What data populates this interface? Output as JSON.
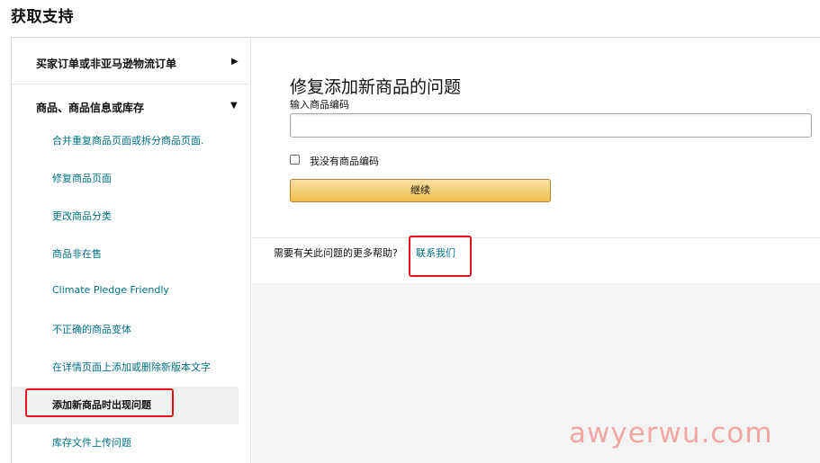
{
  "page": {
    "title": "获取支持"
  },
  "sidebar": {
    "sections": [
      {
        "label": "买家订单或非亚马逊物流订单",
        "state": "collapsed"
      },
      {
        "label": "商品、商品信息或库存",
        "state": "expanded"
      }
    ],
    "items": [
      {
        "label": "合并重复商品页面或拆分商品页面."
      },
      {
        "label": "修复商品页面"
      },
      {
        "label": "更改商品分类"
      },
      {
        "label": "商品非在售"
      },
      {
        "label": "Climate Pledge Friendly"
      },
      {
        "label": "不正确的商品变体"
      },
      {
        "label": "在详情页面上添加或删除新版本文字"
      },
      {
        "label": "添加新商品时出现问题",
        "active": true
      },
      {
        "label": "库存文件上传问题"
      }
    ]
  },
  "form": {
    "title": "修复添加新商品的问题",
    "input_label": "输入商品编码",
    "input_value": "",
    "checkbox_label": "我没有商品编码",
    "checkbox_checked": false,
    "continue_label": "继续"
  },
  "help": {
    "text": "需要有关此问题的更多帮助?",
    "contact_link": "联系我们"
  },
  "watermark": "awyerwu.com",
  "colors": {
    "link": "#007185",
    "highlight": "#e3141b",
    "button": "#f0c14b"
  }
}
